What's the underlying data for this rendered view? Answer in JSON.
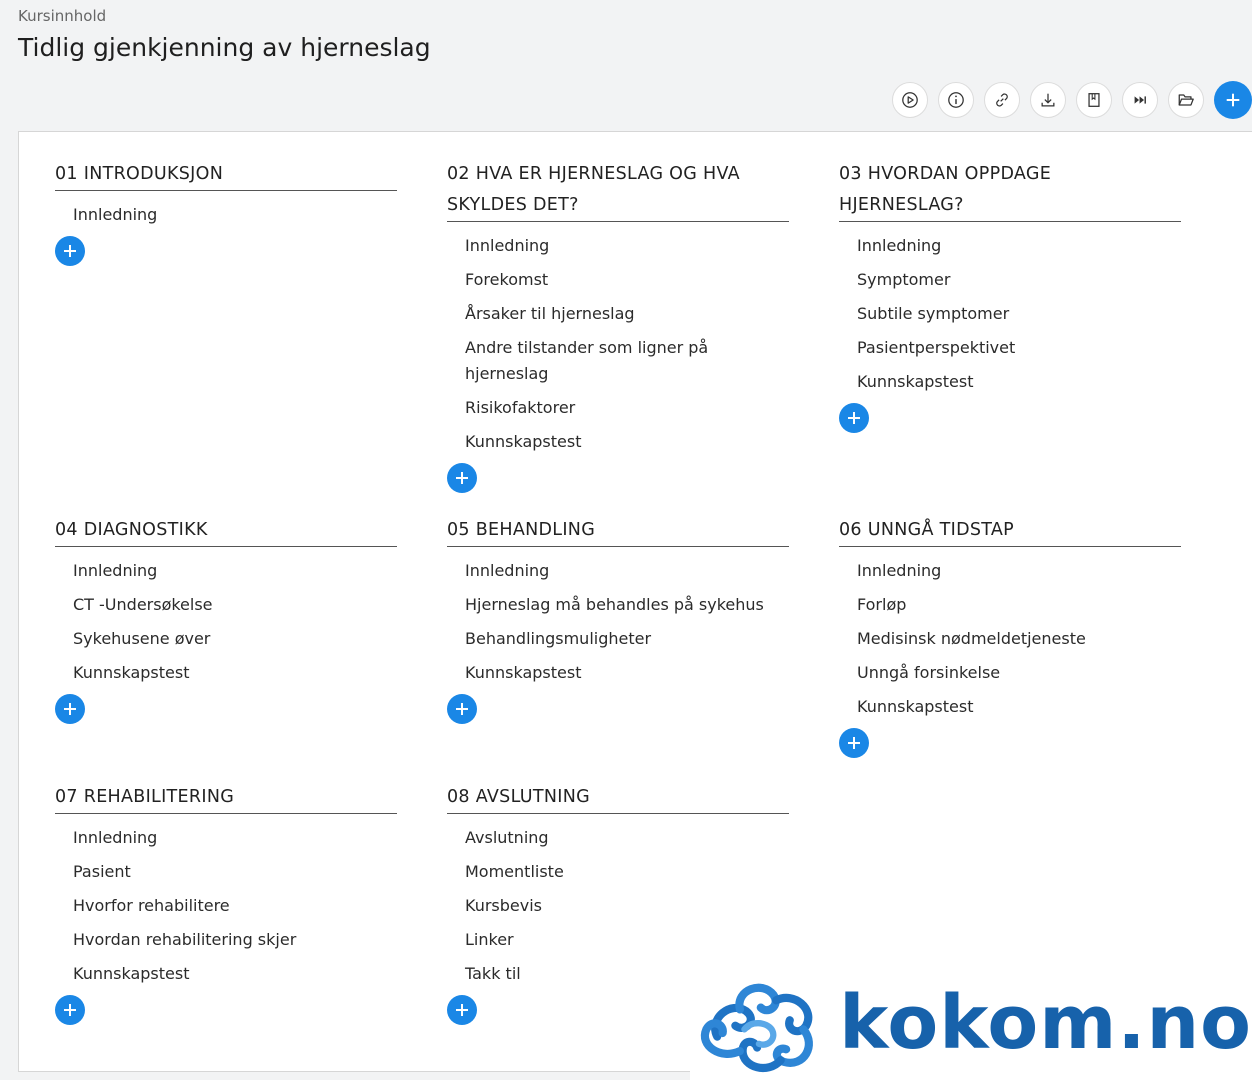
{
  "header": {
    "breadcrumb": "Kursinnhold",
    "title": "Tidlig gjenkjenning av hjerneslag"
  },
  "toolbar": {
    "buttons": [
      {
        "name": "play-icon"
      },
      {
        "name": "info-icon"
      },
      {
        "name": "link-icon"
      },
      {
        "name": "download-icon"
      },
      {
        "name": "bookmark-icon"
      },
      {
        "name": "skip-forward-icon"
      },
      {
        "name": "folder-open-icon"
      },
      {
        "name": "plus-icon"
      }
    ],
    "accent_color": "#1a87e6"
  },
  "modules": [
    {
      "title": "01 INTRODUKSJON",
      "lessons": [
        "Innledning"
      ]
    },
    {
      "title": "02 HVA ER HJERNESLAG OG HVA SKYLDES DET?",
      "lessons": [
        "Innledning",
        "Forekomst",
        "Årsaker til hjerneslag",
        "Andre tilstander som ligner på hjerneslag",
        "Risikofaktorer",
        "Kunnskapstest"
      ]
    },
    {
      "title": "03 HVORDAN OPPDAGE HJERNESLAG?",
      "lessons": [
        "Innledning",
        "Symptomer",
        "Subtile symptomer",
        "Pasientperspektivet",
        "Kunnskapstest"
      ]
    },
    {
      "title": "04 DIAGNOSTIKK",
      "lessons": [
        "Innledning",
        "CT -Undersøkelse",
        "Sykehusene øver",
        "Kunnskapstest"
      ]
    },
    {
      "title": "05 BEHANDLING",
      "lessons": [
        "Innledning",
        "Hjerneslag må behandles på sykehus",
        "Behandlingsmuligheter",
        "Kunnskapstest"
      ]
    },
    {
      "title": "06 UNNGÅ TIDSTAP",
      "lessons": [
        "Innledning",
        "Forløp",
        "Medisinsk nødmeldetjeneste",
        "Unngå forsinkelse",
        "Kunnskapstest"
      ]
    },
    {
      "title": "07 REHABILITERING",
      "lessons": [
        "Innledning",
        "Pasient",
        "Hvorfor rehabilitere",
        "Hvordan rehabilitering skjer",
        "Kunnskapstest"
      ]
    },
    {
      "title": "08 AVSLUTNING",
      "lessons": [
        "Avslutning",
        "Momentliste",
        "Kursbevis",
        "Linker",
        "Takk til"
      ]
    }
  ],
  "logo": {
    "text": "kokom.no",
    "color": "#1762ab"
  }
}
